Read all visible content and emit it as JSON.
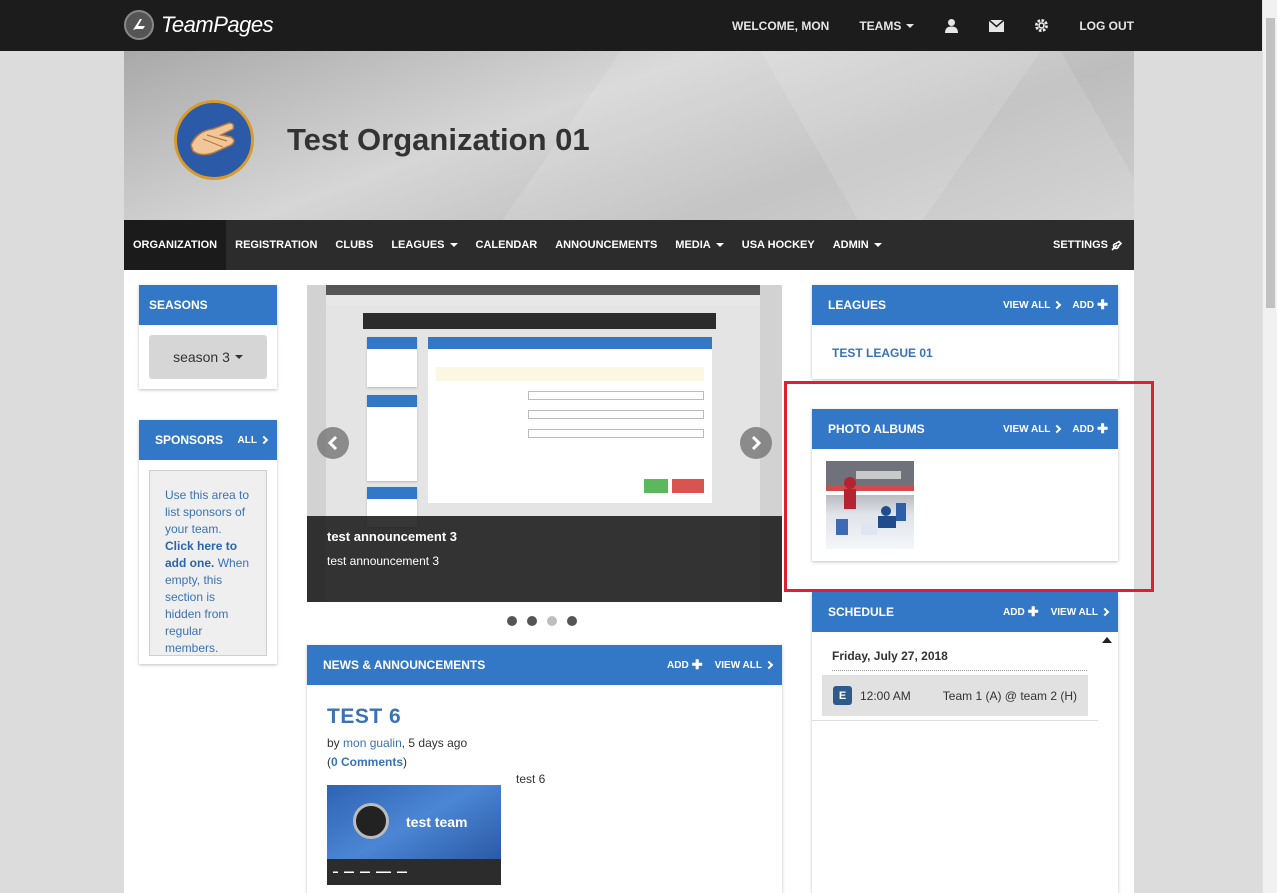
{
  "brand": {
    "name": "TeamPages"
  },
  "topnav": {
    "welcome": "WELCOME, MON",
    "teams": "TEAMS",
    "logout": "LOG OUT"
  },
  "org": {
    "title": "Test Organization 01"
  },
  "mainnav": {
    "items": [
      {
        "label": "ORGANIZATION"
      },
      {
        "label": "REGISTRATION"
      },
      {
        "label": "CLUBS"
      },
      {
        "label": "LEAGUES"
      },
      {
        "label": "CALENDAR"
      },
      {
        "label": "ANNOUNCEMENTS"
      },
      {
        "label": "MEDIA"
      },
      {
        "label": "USA HOCKEY"
      },
      {
        "label": "ADMIN"
      }
    ],
    "settings": "SETTINGS"
  },
  "seasons": {
    "title": "SEASONS",
    "selected": "season 3"
  },
  "sponsors": {
    "title": "SPONSORS",
    "all": "ALL",
    "text_1": "Use this area to list sponsors of your team.",
    "link": "Click here to add one.",
    "text_2": "When empty, this section is hidden from regular members."
  },
  "slideshow": {
    "caption_title": "test announcement 3",
    "caption_text": "test announcement 3",
    "active_index": 2,
    "count": 4
  },
  "news": {
    "title": "NEWS & ANNOUNCEMENTS",
    "add": "ADD",
    "view_all": "VIEW ALL",
    "post_title": "TEST 6",
    "by": "by",
    "author": "mon gualin",
    "when": ", 5 days ago",
    "comments": "0 Comments",
    "body": "test 6",
    "thumb_team": "test team"
  },
  "leagues": {
    "title": "LEAGUES",
    "view_all": "VIEW ALL",
    "add": "ADD",
    "item": "TEST LEAGUE 01"
  },
  "photo_albums": {
    "title": "PHOTO ALBUMS",
    "view_all": "VIEW ALL",
    "add": "ADD"
  },
  "schedule": {
    "title": "SCHEDULE",
    "add": "ADD",
    "view_all": "VIEW ALL",
    "date": "Friday, July 27, 2018",
    "badge": "E",
    "time": "12:00 AM",
    "teams": "Team 1 (A) @ team 2 (H)"
  },
  "colors": {
    "accent": "#3378c7",
    "topbar": "#1c1c1c",
    "nav": "#2c2c2c",
    "highlight": "#d9232f"
  },
  "icons": [
    "user-icon",
    "mail-icon",
    "gear-icon",
    "wrench-icon",
    "chevron-left-icon",
    "chevron-right-icon"
  ]
}
